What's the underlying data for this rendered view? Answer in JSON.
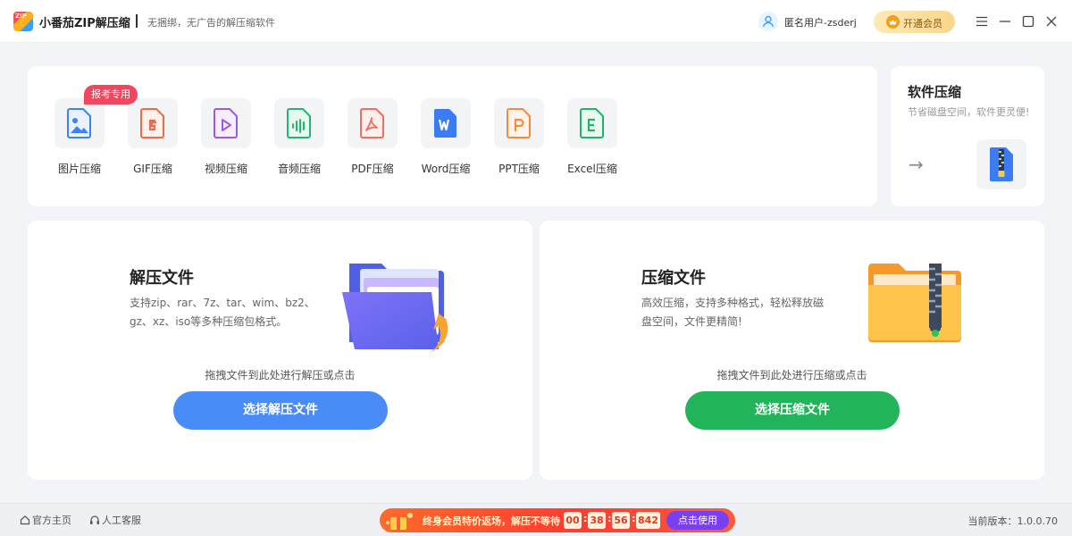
{
  "titlebar": {
    "logo_text": "ZIP",
    "app_title": "小番茄ZIP解压缩",
    "slogan": "无捆绑，无广告的解压缩软件",
    "user_name": "匿名用户-zsderj",
    "vip_label": "开通会员"
  },
  "tools": {
    "badge": "报考专用",
    "items": [
      {
        "label": "图片压缩",
        "icon": "image-icon",
        "color": "#3b82f6"
      },
      {
        "label": "GIF压缩",
        "icon": "gif-icon",
        "color": "#f06a4a"
      },
      {
        "label": "视频压缩",
        "icon": "video-icon",
        "color": "#9b59e6"
      },
      {
        "label": "音频压缩",
        "icon": "audio-icon",
        "color": "#22b573"
      },
      {
        "label": "PDF压缩",
        "icon": "pdf-icon",
        "color": "#f26d5b"
      },
      {
        "label": "Word压缩",
        "icon": "word-icon",
        "color": "#3b7cf5"
      },
      {
        "label": "PPT压缩",
        "icon": "ppt-icon",
        "color": "#f58a3c"
      },
      {
        "label": "Excel压缩",
        "icon": "excel-icon",
        "color": "#21b36b"
      }
    ]
  },
  "software_card": {
    "title": "软件压缩",
    "desc": "节省磁盘空间，软件更灵便!",
    "arrow": "→"
  },
  "extract_card": {
    "title": "解压文件",
    "desc": "支持zip、rar、7z、tar、wim、bz2、gz、xz、iso等多种压缩包格式。",
    "hint": "拖拽文件到此处进行解压或点击",
    "button": "选择解压文件",
    "button_color": "#4a8cf7"
  },
  "compress_card": {
    "title": "压缩文件",
    "desc": "高效压缩，支持多种格式，轻松释放磁盘空间，文件更精简!",
    "hint": "拖拽文件到此处进行压缩或点击",
    "button": "选择压缩文件",
    "button_color": "#22b45a"
  },
  "footer": {
    "home_link": "官方主页",
    "service_link": "人工客服",
    "promo_text": "终身会员特价返场，解压不等待",
    "timer": [
      "00",
      "38",
      "56",
      "842"
    ],
    "timer_sep": ":",
    "promo_button": "点击使用",
    "version": "当前版本：1.0.0.70"
  }
}
